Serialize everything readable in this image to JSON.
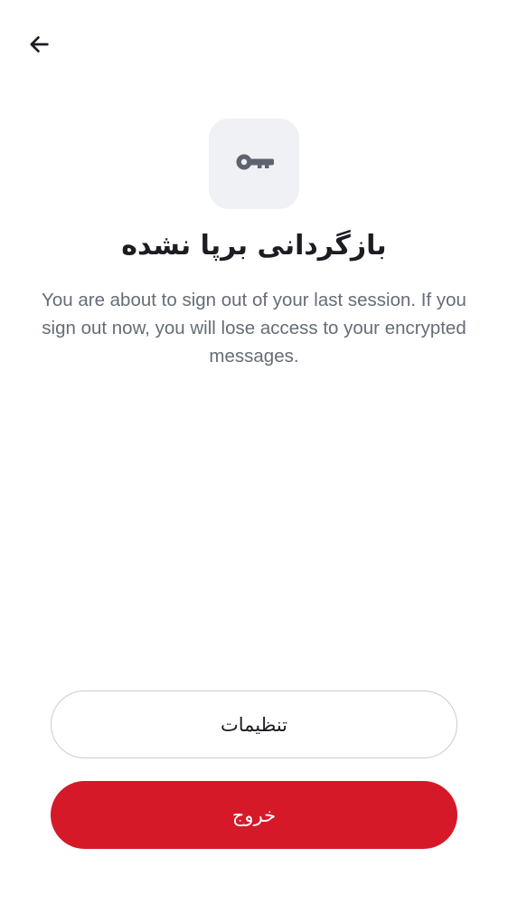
{
  "header": {
    "back_icon": "arrow-left-icon"
  },
  "hero": {
    "icon": "key-icon",
    "icon_tile_color": "#eff1f5"
  },
  "title": "بازگردانی برپا نشده",
  "description": "You are about to sign out of your last session. If you sign out now, you will lose access to your encrypted messages.",
  "actions": {
    "settings_label": "تنظیمات",
    "sign_out_label": "خروج"
  },
  "colors": {
    "accent_danger": "#d51928",
    "title_text": "#1b1d22",
    "body_text": "#656d77",
    "outline": "#c9ccd1"
  }
}
